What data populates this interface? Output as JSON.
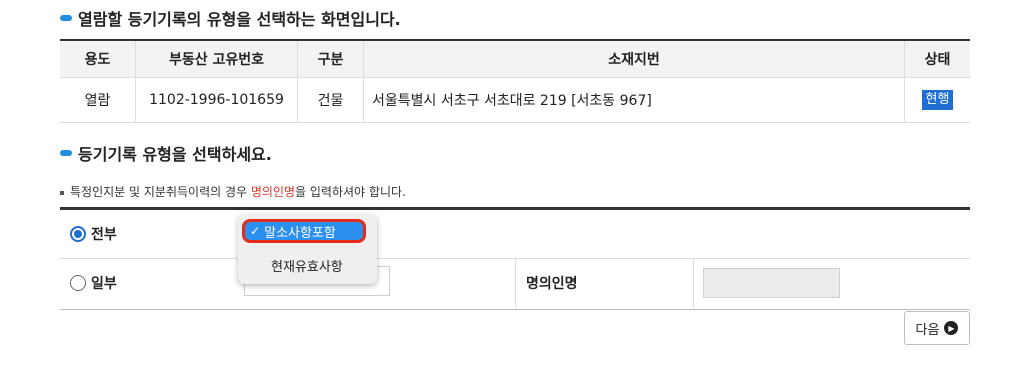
{
  "header": {
    "title": "열람할 등기기록의 유형을 선택하는 화면입니다."
  },
  "info_table": {
    "columns": [
      "용도",
      "부동산 고유번호",
      "구분",
      "소재지번",
      "상태"
    ],
    "row": {
      "purpose": "열람",
      "unique_no": "1102-1996-101659",
      "category": "건물",
      "address": "서울특별시 서초구 서초대로 219 [서초동 967]",
      "status": "현행"
    }
  },
  "section2": {
    "title": "등기기록 유형을 선택하세요."
  },
  "notice": {
    "before": "특정인지분 및 지분취득이력의 경우 ",
    "highlight": "명의인명",
    "after": "을 입력하셔야 합니다."
  },
  "form": {
    "option_all": "전부",
    "option_partial": "일부",
    "owner_name_label": "명의인명",
    "owner_name_value": "",
    "partial_select_partial_text": "현재유효사항"
  },
  "dropdown": {
    "options": [
      "말소사항포함",
      "현재유효사항"
    ],
    "selected_index": 0
  },
  "buttons": {
    "next": "다음"
  },
  "colors": {
    "accent": "#1f6fd3",
    "highlight": "#d9362b",
    "selection": "#2b8ff0"
  }
}
